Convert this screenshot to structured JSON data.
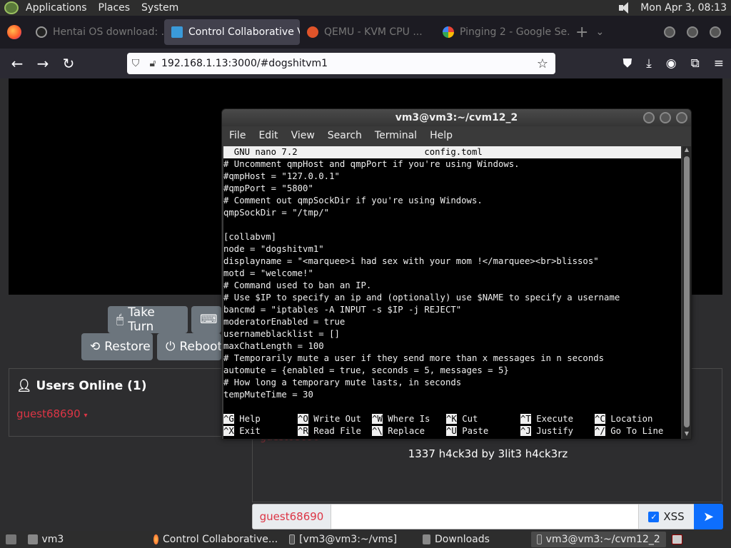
{
  "top_panel": {
    "menus": [
      "Applications",
      "Places",
      "System"
    ],
    "clock": "Mon Apr  3, 08:13"
  },
  "browser": {
    "tabs": [
      {
        "label": "Hentai OS download: ...",
        "active": false
      },
      {
        "label": "Control Collaborative V",
        "active": true
      },
      {
        "label": "QEMU - KVM CPU ...",
        "active": false
      },
      {
        "label": "Pinging 2 - Google Se...",
        "active": false
      }
    ],
    "url": "192.168.1.13:3000/#dogshitvm1"
  },
  "page": {
    "buttons": {
      "take_turn": "Take Turn",
      "restore": "Restore",
      "reboot": "Reboot"
    },
    "users_title": "Users Online (1)",
    "user_name": "guest68690",
    "chat_ghost_name": "guest68690",
    "chat_message": "1337 h4ck3d by 3lit3 h4ck3rz",
    "chat_username": "guest68690",
    "xss_label": "XSS",
    "colors": {
      "accent": "#0d6efd",
      "username": "#dc3545",
      "button": "#6c757d"
    }
  },
  "terminal": {
    "title": "vm3@vm3:~/cvm12_2",
    "menu": [
      "File",
      "Edit",
      "View",
      "Search",
      "Terminal",
      "Help"
    ],
    "nano_header": "  GNU nano 7.2                        config.toml",
    "lines": [
      "# Uncomment qmpHost and qmpPort if you're using Windows.",
      "#qmpHost = \"127.0.0.1\"",
      "#qmpPort = \"5800\"",
      "# Comment out qmpSockDir if you're using Windows.",
      "qmpSockDir = \"/tmp/\"",
      "",
      "[collabvm]",
      "node = \"dogshitvm1\"",
      "displayname = \"<marquee>i had sex with your mom !</marquee><br>blissos\"",
      "motd = \"welcome!\"",
      "# Command used to ban an IP.",
      "# Use $IP to specify an ip and (optionally) use $NAME to specify a username",
      "bancmd = \"iptables -A INPUT -s $IP -j REJECT\"",
      "moderatorEnabled = true",
      "usernameblacklist = []",
      "maxChatLength = 100",
      "# Temporarily mute a user if they send more than x messages in n seconds",
      "automute = {enabled = true, seconds = 5, messages = 5}",
      "# How long a temporary mute lasts, in seconds",
      "tempMuteTime = 30",
      ""
    ],
    "shortcuts_row1": [
      {
        "key": "^G",
        "label": "Help"
      },
      {
        "key": "^O",
        "label": "Write Out"
      },
      {
        "key": "^W",
        "label": "Where Is"
      },
      {
        "key": "^K",
        "label": "Cut"
      },
      {
        "key": "^T",
        "label": "Execute"
      },
      {
        "key": "^C",
        "label": "Location"
      }
    ],
    "shortcuts_row2": [
      {
        "key": "^X",
        "label": "Exit"
      },
      {
        "key": "^R",
        "label": "Read File"
      },
      {
        "key": "^\\",
        "label": "Replace"
      },
      {
        "key": "^U",
        "label": "Paste"
      },
      {
        "key": "^J",
        "label": "Justify"
      },
      {
        "key": "^/",
        "label": "Go To Line"
      }
    ]
  },
  "taskbar": {
    "items": [
      {
        "label": "vm3",
        "active": false
      },
      {
        "label": "Control Collaborative...",
        "active": false
      },
      {
        "label": "[vm3@vm3:~/vms]",
        "active": false
      },
      {
        "label": "Downloads",
        "active": false
      },
      {
        "label": "vm3@vm3:~/cvm12_2",
        "active": true
      }
    ]
  }
}
